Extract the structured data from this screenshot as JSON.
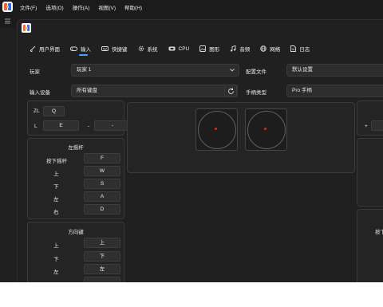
{
  "menubar": {
    "items": [
      "文件(F)",
      "选项(O)",
      "操作(A)",
      "视图(V)",
      "帮助(H)"
    ]
  },
  "tabs": [
    {
      "label": "用户界面",
      "icon": "brush-icon"
    },
    {
      "label": "输入",
      "icon": "gamepad-icon"
    },
    {
      "label": "快捷键",
      "icon": "keyboard-icon"
    },
    {
      "label": "系统",
      "icon": "gear-icon"
    },
    {
      "label": "CPU",
      "icon": "cpu-icon"
    },
    {
      "label": "图形",
      "icon": "image-icon"
    },
    {
      "label": "音频",
      "icon": "music-icon"
    },
    {
      "label": "网络",
      "icon": "globe-icon"
    },
    {
      "label": "日志",
      "icon": "log-icon"
    }
  ],
  "active_tab": "输入",
  "form": {
    "player_label": "玩家",
    "player_value": "玩家 1",
    "profile_label": "配置文件",
    "profile_value": "默认设置",
    "device_label": "输入设备",
    "device_value": "所有键盘",
    "controller_type_label": "手柄类型",
    "controller_type_value": "Pro 手柄"
  },
  "triggers": {
    "zl_label": "ZL",
    "zl_key": "Q",
    "l_label": "L",
    "l_key": "E",
    "minus_label": "-",
    "minus_key": "-"
  },
  "left_stick": {
    "title": "左摇杆",
    "rows": [
      {
        "label": "按下摇杆",
        "key": "F"
      },
      {
        "label": "上",
        "key": "W"
      },
      {
        "label": "下",
        "key": "S"
      },
      {
        "label": "左",
        "key": "A"
      },
      {
        "label": "右",
        "key": "D"
      }
    ]
  },
  "dpad": {
    "title": "方向键",
    "rows": [
      {
        "label": "上",
        "key": "上"
      },
      {
        "label": "下",
        "key": "下"
      },
      {
        "label": "左",
        "key": "左"
      }
    ]
  },
  "right_partial": {
    "plus_label": "+",
    "press_label_partial": "按下"
  },
  "colors": {
    "accent": "#4aa3ff",
    "stick_dot": "#e02424",
    "background": "#202020"
  }
}
